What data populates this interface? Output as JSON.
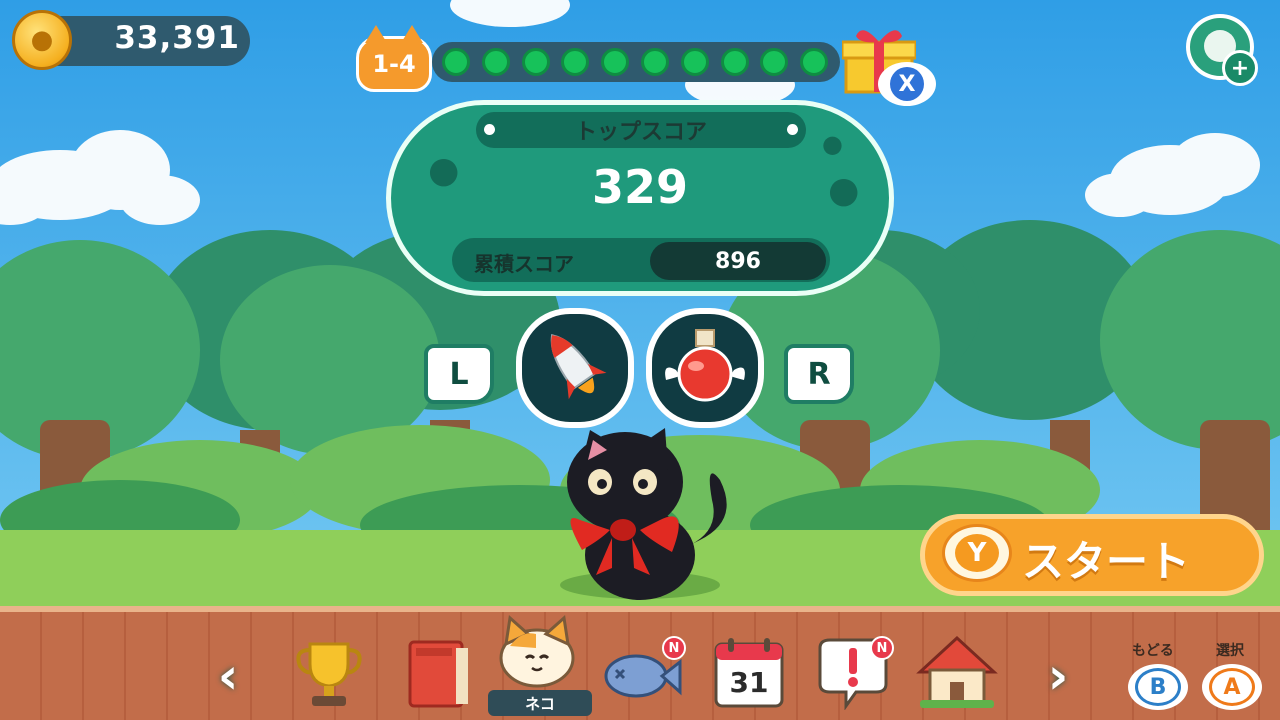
{
  "coins": {
    "amount": "33,391",
    "icon": "paw-coin-icon"
  },
  "level": {
    "label": "1-4",
    "progress_total": 10,
    "progress_filled": 10
  },
  "reward": {
    "icon": "gift-box-icon",
    "close_button": "X"
  },
  "score_panel": {
    "title": "トップスコア",
    "top_score": "329",
    "cumulative_label": "累積スコア",
    "cumulative_value": "896"
  },
  "items": {
    "left_shoulder": "L",
    "right_shoulder": "R",
    "slots": [
      {
        "icon": "rocket-icon"
      },
      {
        "icon": "potion-icon"
      }
    ]
  },
  "start_button": {
    "key": "Y",
    "label": "スタート"
  },
  "bottom_menu": {
    "items": [
      {
        "icon": "trophy-icon",
        "badge": ""
      },
      {
        "icon": "book-icon",
        "badge": ""
      },
      {
        "icon": "cat-face-icon",
        "badge": "",
        "label": "ネコ",
        "selected": true
      },
      {
        "icon": "fish-icon",
        "badge": "N"
      },
      {
        "icon": "calendar-icon",
        "badge": "",
        "day": "31"
      },
      {
        "icon": "notice-icon",
        "badge": "N"
      },
      {
        "icon": "house-icon",
        "badge": ""
      }
    ]
  },
  "controls": {
    "back": {
      "label": "もどる",
      "key": "B"
    },
    "select": {
      "label": "選択",
      "key": "A"
    }
  },
  "colors": {
    "panel": "#1f9a7c",
    "start": "#f7a22a",
    "bar": "#c26d4a",
    "progress_dot": "#17c25a"
  }
}
